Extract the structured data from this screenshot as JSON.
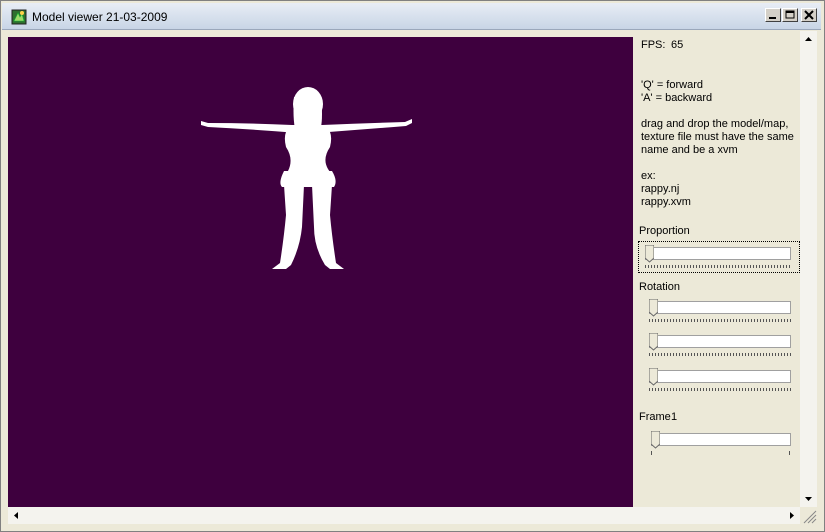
{
  "window": {
    "title": "Model viewer 21-03-2009",
    "controls": [
      "minimize",
      "maximize",
      "close"
    ]
  },
  "viewport": {
    "background": "#3e003e",
    "model_color": "#ffffff"
  },
  "panel": {
    "fps_label": "FPS:",
    "fps_value": "65",
    "help_keys": [
      "'Q' = forward",
      "'A' = backward"
    ],
    "help_drag": [
      "drag and drop the model/map,",
      "texture file must have the same",
      "name and be a xvm"
    ],
    "example_label": "ex:",
    "example_files": [
      "rappy.nj",
      "rappy.xvm"
    ],
    "proportion_label": "Proportion",
    "proportion_value": 0.0,
    "rotation_label": "Rotation",
    "rotation_values": [
      0.0,
      0.0,
      0.0
    ],
    "frame_label": "Frame",
    "frame_number": "1",
    "frame_value": 0.0
  },
  "scrollbars": {
    "vertical_position": 0.0,
    "horizontal_position": 0.0
  }
}
